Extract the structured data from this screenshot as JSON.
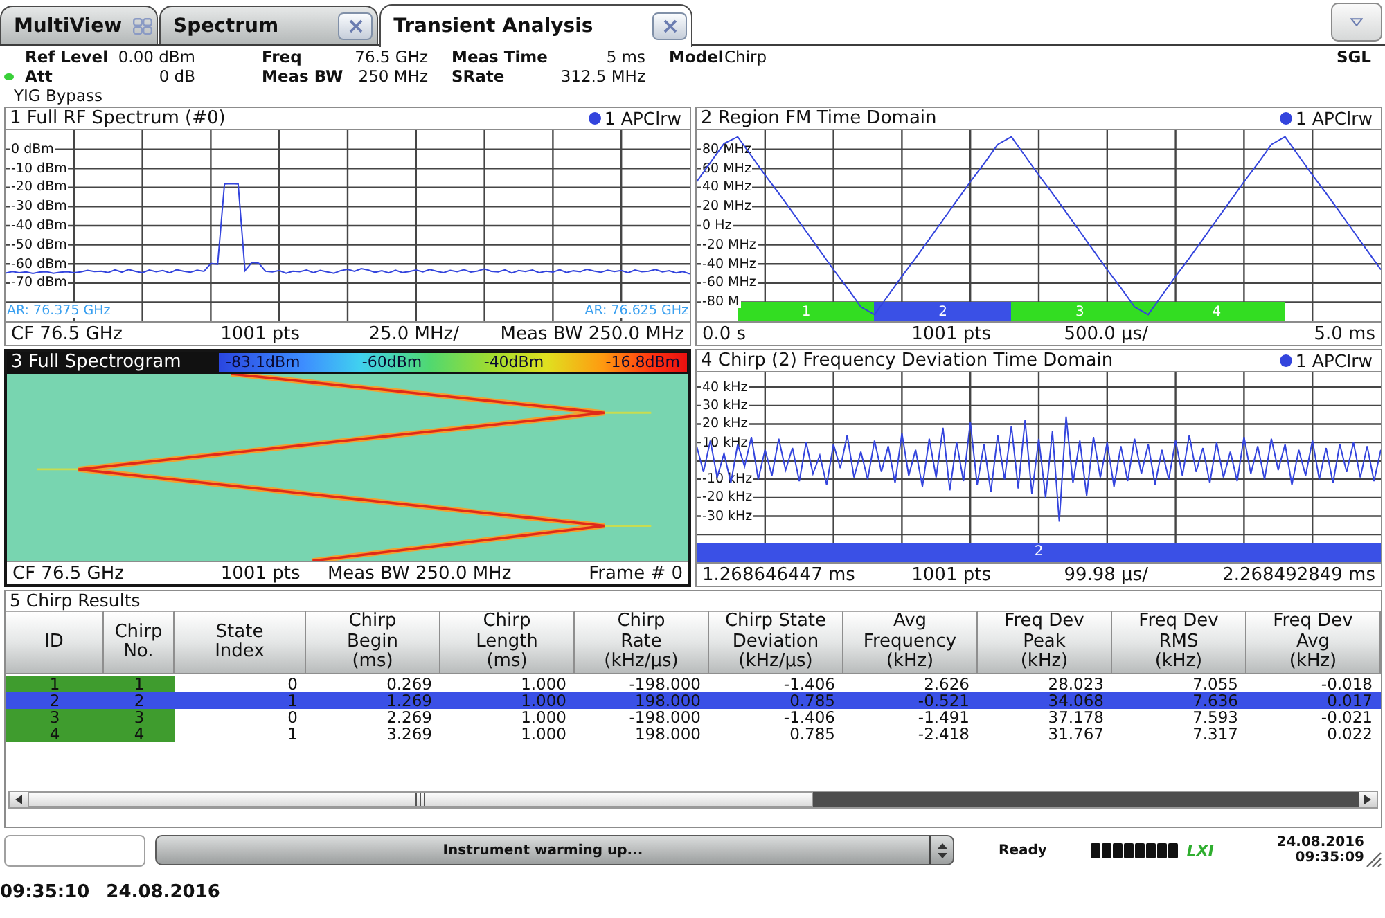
{
  "tabs": [
    {
      "label": "MultiView",
      "kind": "overview",
      "selected": false
    },
    {
      "label": "Spectrum",
      "kind": "channel",
      "selected": false
    },
    {
      "label": "Transient Analysis",
      "kind": "channel",
      "selected": true
    }
  ],
  "settings": [
    [
      {
        "label": "Ref Level",
        "value": "0.00 dBm",
        "indicator": false
      },
      {
        "label": "Att",
        "value": "0 dB",
        "indicator": true
      }
    ],
    [
      {
        "label": "Freq",
        "value": "76.5 GHz",
        "indicator": false
      },
      {
        "label": "Meas BW",
        "value": "250 MHz",
        "indicator": false
      }
    ],
    [
      {
        "label": "Meas Time",
        "value": "5 ms",
        "indicator": false
      },
      {
        "label": "SRate",
        "value": "312.5 MHz",
        "indicator": false
      }
    ],
    [
      {
        "label": "Model",
        "value": "Chirp",
        "indicator": false
      }
    ]
  ],
  "settings_note": "YIG Bypass",
  "sweep_mode": "SGL",
  "windows": [
    {
      "kind": "spectrum",
      "title": "1 Full RF Spectrum (#0)",
      "focused": false,
      "chart_data": {
        "type": "line",
        "grid": true,
        "ylim": [
          -90,
          10
        ],
        "yticks": [
          {
            "value": 0,
            "label": "0 dBm"
          },
          {
            "value": -10,
            "label": "-10 dBm"
          },
          {
            "value": -20,
            "label": "-20 dBm"
          },
          {
            "value": -30,
            "label": "-30 dBm"
          },
          {
            "value": -40,
            "label": "-40 dBm"
          },
          {
            "value": -50,
            "label": "-50 dBm"
          },
          {
            "value": -60,
            "label": "-60 dBm"
          },
          {
            "value": -70,
            "label": "-70 dBm"
          }
        ],
        "categories": [
          null,
          null,
          null,
          null,
          null,
          null,
          null,
          null,
          null,
          null,
          null,
          null,
          null,
          null,
          null,
          null,
          null,
          null,
          null,
          null,
          null,
          null,
          null,
          null,
          null,
          null,
          null,
          null,
          null,
          null,
          null,
          null,
          null,
          null,
          null,
          null,
          null,
          null,
          null,
          null,
          null,
          null,
          null,
          null,
          null,
          null,
          null,
          null,
          null,
          null,
          null,
          null,
          null,
          null,
          null,
          null,
          null,
          null,
          null,
          null,
          null,
          null,
          null,
          null,
          null,
          null,
          null,
          null,
          null,
          null,
          null,
          null,
          null,
          null,
          null,
          null,
          null,
          null,
          null,
          null,
          null,
          null,
          null,
          null,
          null,
          null,
          null,
          null,
          null,
          null,
          null,
          null,
          null,
          null,
          null,
          null,
          null,
          null,
          null,
          null,
          null
        ],
        "series": [
          {
            "name": "1 APClrw",
            "color": "#3344dd",
            "values": [
              -64.8,
              -64.0,
              -64.6,
              -64.2,
              -65.0,
              -64.3,
              -64.1,
              -64.9,
              -64.4,
              -64.1,
              -64.6,
              -64.2,
              -63.4,
              -64.0,
              -63.8,
              -64.5,
              -63.1,
              -64.3,
              -62.9,
              -63.9,
              -64.6,
              -63.2,
              -64.1,
              -63.5,
              -64.7,
              -63.0,
              -63.8,
              -64.4,
              -63.3,
              -63.9,
              -59.8,
              -60.2,
              -18.2,
              -18.0,
              -18.2,
              -63.5,
              -59.2,
              -59.6,
              -63.8,
              -64.2,
              -63.5,
              -64.9,
              -63.8,
              -64.1,
              -63.2,
              -64.6,
              -63.4,
              -64.2,
              -64.9,
              -63.5,
              -62.8,
              -63.9,
              -62.5,
              -63.2,
              -64.4,
              -63.6,
              -64.7,
              -63.3,
              -64.5,
              -64.0,
              -63.2,
              -64.2,
              -62.9,
              -63.8,
              -64.6,
              -63.4,
              -64.1,
              -63.0,
              -64.3,
              -63.7,
              -62.6,
              -63.9,
              -64.2,
              -63.1,
              -64.8,
              -63.5,
              -64.0,
              -63.2,
              -64.6,
              -63.8,
              -64.3,
              -63.0,
              -64.5,
              -63.6,
              -64.1,
              -62.8,
              -63.7,
              -64.4,
              -63.3,
              -64.0,
              -63.5,
              -64.6,
              -63.2,
              -64.1,
              -63.8,
              -62.9,
              -64.2,
              -63.6,
              -64.7,
              -64.0,
              -65.2
            ]
          }
        ]
      },
      "range_labels": [
        "AR: 76.375 GHz",
        "AR: 76.625 GHz"
      ],
      "footer": [
        "CF 76.5 GHz",
        "1001 pts",
        "25.0 MHz/",
        "Meas BW 250.0 MHz"
      ]
    },
    {
      "kind": "time_domain",
      "title": "2 Region FM Time Domain",
      "focused": false,
      "chart_data": {
        "type": "line",
        "grid": true,
        "ylim": [
          -100,
          100
        ],
        "yticks": [
          {
            "value": 80,
            "label": "80 MHz"
          },
          {
            "value": 60,
            "label": "60 MHz"
          },
          {
            "value": 40,
            "label": "40 MHz"
          },
          {
            "value": 20,
            "label": "20 MHz"
          },
          {
            "value": 0,
            "label": "0 Hz"
          },
          {
            "value": -20,
            "label": "-20 MHz"
          },
          {
            "value": -40,
            "label": "-40 MHz"
          },
          {
            "value": -60,
            "label": "-60 MHz"
          },
          {
            "value": -80,
            "label": "-80 M"
          }
        ],
        "categories": [
          null,
          null,
          null,
          null,
          null,
          null,
          null,
          null,
          null,
          null,
          null,
          null,
          null,
          null,
          null,
          null,
          null,
          null,
          null,
          null,
          null,
          null,
          null,
          null,
          null,
          null,
          null,
          null,
          null,
          null,
          null,
          null,
          null,
          null,
          null,
          null,
          null,
          null,
          null,
          null,
          null,
          null,
          null,
          null,
          null,
          null,
          null,
          null,
          null,
          null,
          null
        ],
        "series": [
          {
            "name": "1 APClrw",
            "color": "#3344dd",
            "values": [
              46,
              66,
              86,
              93,
              73,
              53,
              34,
              14,
              -6,
              -26,
              -46,
              -65,
              -85,
              -93,
              -73,
              -53,
              -34,
              -14,
              6,
              26,
              46,
              65,
              85,
              93,
              73,
              53,
              34,
              14,
              -6,
              -26,
              -46,
              -65,
              -85,
              -93,
              -73,
              -53,
              -34,
              -14,
              6,
              26,
              46,
              65,
              85,
              93,
              73,
              53,
              34,
              14,
              -6,
              -26,
              -46
            ]
          }
        ]
      },
      "regions": [
        {
          "label": "1",
          "color": "#33dd22"
        },
        {
          "label": "2",
          "color": "#3a50e6"
        },
        {
          "label": "3",
          "color": "#33dd22"
        },
        {
          "label": "4",
          "color": "#33dd22"
        }
      ],
      "footer": [
        "0.0 s",
        "1001 pts",
        "500.0 µs/",
        "5.0 ms"
      ]
    },
    {
      "kind": "spectrogram",
      "title": "3 Full Spectrogram",
      "focused": true,
      "color_scale": [
        "-83.1dBm",
        "-60dBm",
        "-40dBm",
        "-16.8dBm"
      ],
      "footer": [
        "CF 76.5 GHz",
        "1001 pts",
        "Meas BW 250.0 MHz",
        "Frame # 0"
      ]
    },
    {
      "kind": "deviation",
      "title": "4 Chirp (2) Frequency Deviation Time Domain",
      "focused": false,
      "chart_data": {
        "type": "line",
        "grid": true,
        "ylim": [
          -55,
          48
        ],
        "yticks": [
          {
            "value": 40,
            "label": "40 kHz"
          },
          {
            "value": 30,
            "label": "30 kHz"
          },
          {
            "value": 20,
            "label": "20 kHz"
          },
          {
            "value": 10,
            "label": "10 kHz"
          },
          {
            "value": -10,
            "label": "-10 kHz"
          },
          {
            "value": -20,
            "label": "-20 kHz"
          },
          {
            "value": -30,
            "label": "-30 kHz"
          }
        ],
        "categories": [
          null,
          null,
          null,
          null,
          null,
          null,
          null,
          null,
          null,
          null,
          null,
          null,
          null,
          null,
          null,
          null,
          null,
          null,
          null,
          null,
          null,
          null,
          null,
          null,
          null,
          null,
          null,
          null,
          null,
          null,
          null,
          null,
          null,
          null,
          null,
          null,
          null,
          null,
          null,
          null,
          null,
          null,
          null,
          null,
          null,
          null,
          null,
          null,
          null,
          null,
          null,
          null,
          null,
          null,
          null,
          null,
          null,
          null,
          null,
          null,
          null,
          null,
          null,
          null,
          null,
          null,
          null,
          null,
          null,
          null,
          null,
          null,
          null,
          null,
          null,
          null,
          null,
          null,
          null,
          null,
          null,
          null,
          null,
          null,
          null,
          null,
          null,
          null,
          null,
          null,
          null,
          null,
          null,
          null,
          null,
          null,
          null,
          null,
          null,
          null,
          null
        ],
        "series": [
          {
            "name": "1 APClrw",
            "color": "#3344dd",
            "values": [
              8,
              -6,
              11,
              -9,
              4,
              -12,
              9,
              -3,
              13,
              -10,
              6,
              -8,
              12,
              -5,
              7,
              -11,
              10,
              -7,
              3,
              -13,
              9,
              -4,
              14,
              -9,
              5,
              -10,
              11,
              -6,
              8,
              -12,
              15,
              -8,
              6,
              -14,
              12,
              -9,
              18,
              -16,
              10,
              -11,
              21,
              -13,
              9,
              -17,
              14,
              -10,
              19,
              -15,
              22,
              -18,
              12,
              -20,
              16,
              -33,
              24,
              -12,
              11,
              -19,
              13,
              -9,
              10,
              -14,
              8,
              -11,
              12,
              -7,
              9,
              -13,
              6,
              -10,
              11,
              -8,
              14,
              -6,
              7,
              -12,
              10,
              -9,
              5,
              -11,
              13,
              -7,
              8,
              -10,
              12,
              -5,
              9,
              -13,
              6,
              -8,
              11,
              -10,
              7,
              -12,
              9,
              -6,
              10,
              -9,
              8,
              -11,
              6
            ]
          }
        ]
      },
      "region_label": "2",
      "footer": [
        "1.268646447 ms",
        "1001 pts",
        "99.98 µs/",
        "2.268492849 ms"
      ]
    }
  ],
  "results": {
    "title": "5 Chirp Results",
    "columns": [
      {
        "label": "ID",
        "kind": "key"
      },
      {
        "label": "Chirp\nNo.",
        "kind": "key"
      },
      {
        "label": "State\nIndex",
        "kind": "value"
      },
      {
        "label": "Chirp\nBegin\n(ms)",
        "kind": "value"
      },
      {
        "label": "Chirp\nLength\n(ms)",
        "kind": "value"
      },
      {
        "label": "Chirp\nRate\n(kHz/µs)",
        "kind": "value"
      },
      {
        "label": "Chirp State\nDeviation\n(kHz/µs)",
        "kind": "value"
      },
      {
        "label": "Avg\nFrequency\n(kHz)",
        "kind": "value"
      },
      {
        "label": "Freq Dev\nPeak\n(kHz)",
        "kind": "value"
      },
      {
        "label": "Freq Dev\nRMS\n(kHz)",
        "kind": "value"
      },
      {
        "label": "Freq Dev\nAvg\n(kHz)",
        "kind": "value"
      }
    ],
    "rows": [
      {
        "selected": false,
        "cells": [
          "1",
          "1",
          "0",
          "0.269",
          "1.000",
          "-198.000",
          "-1.406",
          "2.626",
          "28.023",
          "7.055",
          "-0.018"
        ]
      },
      {
        "selected": true,
        "cells": [
          "2",
          "2",
          "1",
          "1.269",
          "1.000",
          "198.000",
          "0.785",
          "-0.521",
          "34.068",
          "7.636",
          "0.017"
        ]
      },
      {
        "selected": false,
        "cells": [
          "3",
          "3",
          "0",
          "2.269",
          "1.000",
          "-198.000",
          "-1.406",
          "-1.491",
          "37.178",
          "7.593",
          "-0.021"
        ]
      },
      {
        "selected": false,
        "cells": [
          "4",
          "4",
          "1",
          "3.269",
          "1.000",
          "198.000",
          "0.785",
          "-2.418",
          "31.767",
          "7.317",
          "0.022"
        ]
      }
    ]
  },
  "status_bar": {
    "message": "Instrument warming up...",
    "state": "Ready",
    "logo": "LXI",
    "date": "24.08.2016",
    "time": "09:35:09"
  },
  "timestamp": {
    "time": "09:35:10",
    "date": "24.08.2016"
  }
}
